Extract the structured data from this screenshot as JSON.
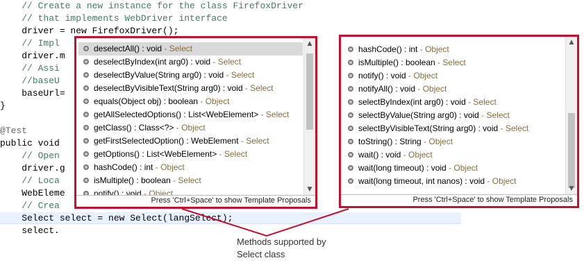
{
  "editor": {
    "lines": [
      "    // Create a new instance for the class FirefoxDriver",
      "    // that implements WebDriver interface",
      "    driver = new FirefoxDriver();",
      "    // Impl",
      "    driver.m                                                      it.S",
      "    // Assi                                                      leni",
      "    //baseU                                                      e/in",
      "    baseUrl=",
      "}",
      "",
      "@Test",
      "public void",
      "    // Open",
      "    driver.g",
      "    // Loca                                                      l",
      "    WebEleme                                                      prog",
      "    // Crea                                                       the",
      "    Select select = new Select(langSelect);",
      "    select."
    ]
  },
  "left_popup": {
    "items": [
      {
        "method": "deselectAll() : void",
        "owner": "Select"
      },
      {
        "method": "deselectByIndex(int arg0) : void",
        "owner": "Select"
      },
      {
        "method": "deselectByValue(String arg0) : void",
        "owner": "Select"
      },
      {
        "method": "deselectByVisibleText(String arg0) : void",
        "owner": "Select"
      },
      {
        "method": "equals(Object obj) : boolean",
        "owner": "Object"
      },
      {
        "method": "getAllSelectedOptions() : List<WebElement>",
        "owner": "Select"
      },
      {
        "method": "getClass() : Class<?>",
        "owner": "Object"
      },
      {
        "method": "getFirstSelectedOption() : WebElement",
        "owner": "Select"
      },
      {
        "method": "getOptions() : List<WebElement>",
        "owner": "Select"
      },
      {
        "method": "hashCode() : int",
        "owner": "Object"
      },
      {
        "method": "isMultiple() : boolean",
        "owner": "Select"
      },
      {
        "method": "notify() : void",
        "owner": "Object"
      }
    ],
    "footer": "Press 'Ctrl+Space' to show Template Proposals"
  },
  "right_popup": {
    "items": [
      {
        "method": "hashCode() : int",
        "owner": "Object"
      },
      {
        "method": "isMultiple() : boolean",
        "owner": "Select"
      },
      {
        "method": "notify() : void",
        "owner": "Object"
      },
      {
        "method": "notifyAll() : void",
        "owner": "Object"
      },
      {
        "method": "selectByIndex(int arg0) : void",
        "owner": "Select"
      },
      {
        "method": "selectByValue(String arg0) : void",
        "owner": "Select"
      },
      {
        "method": "selectByVisibleText(String arg0) : void",
        "owner": "Select"
      },
      {
        "method": "toString() : String",
        "owner": "Object"
      },
      {
        "method": "wait() : void",
        "owner": "Object"
      },
      {
        "method": "wait(long timeout) : void",
        "owner": "Object"
      },
      {
        "method": "wait(long timeout, int nanos) : void",
        "owner": "Object"
      }
    ],
    "footer": "Press 'Ctrl+Space' to show Template Proposals"
  },
  "annotation": {
    "line1": "Methods supported by",
    "line2": "Select class"
  },
  "colors": {
    "highlight_border": "#c8102e",
    "owner_text": "#8a6d3b",
    "comment": "#3f7f5f",
    "selected_row": "#d9d9d9"
  },
  "icons": {
    "method": "method-dot-icon",
    "scroll_up": "scroll-up-arrow-icon",
    "scroll_down": "scroll-down-arrow-icon"
  }
}
